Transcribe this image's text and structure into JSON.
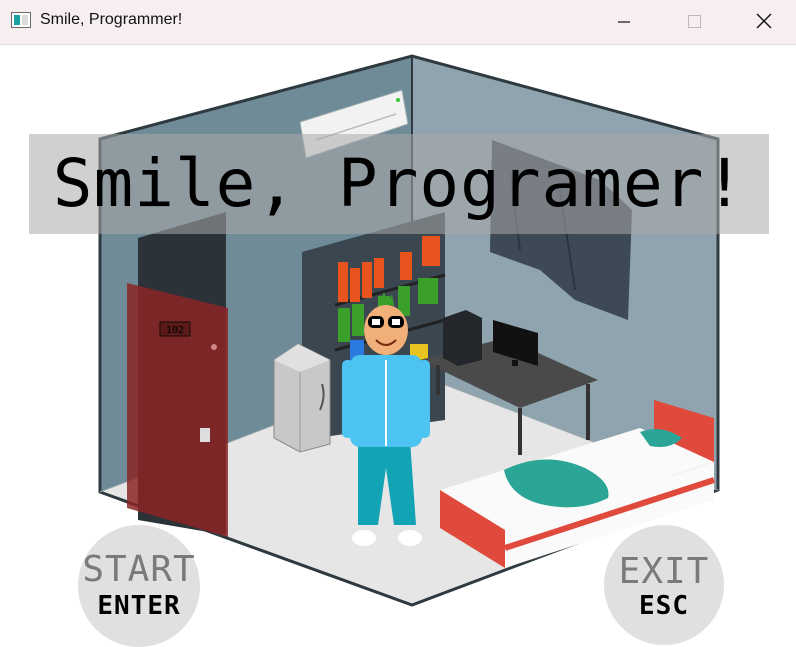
{
  "window": {
    "title": "Smile, Programmer!",
    "minimize_icon": "minimize-icon",
    "maximize_icon": "maximize-icon",
    "close_icon": "close-icon"
  },
  "game": {
    "title": "Smile, Programer!",
    "room_number": "102",
    "start": {
      "label": "START",
      "key": "ENTER"
    },
    "exit": {
      "label": "EXIT",
      "key": "ESC"
    }
  },
  "colors": {
    "titlebar": "#f7eef0",
    "banner": "#aaaaaa",
    "button_bg": "#e0e0e0",
    "door": "#8b2424",
    "bed_frame": "#e04a3c",
    "blanket": "#2aa596",
    "shirt": "#4cc3f0",
    "pants": "#12a3b5"
  }
}
